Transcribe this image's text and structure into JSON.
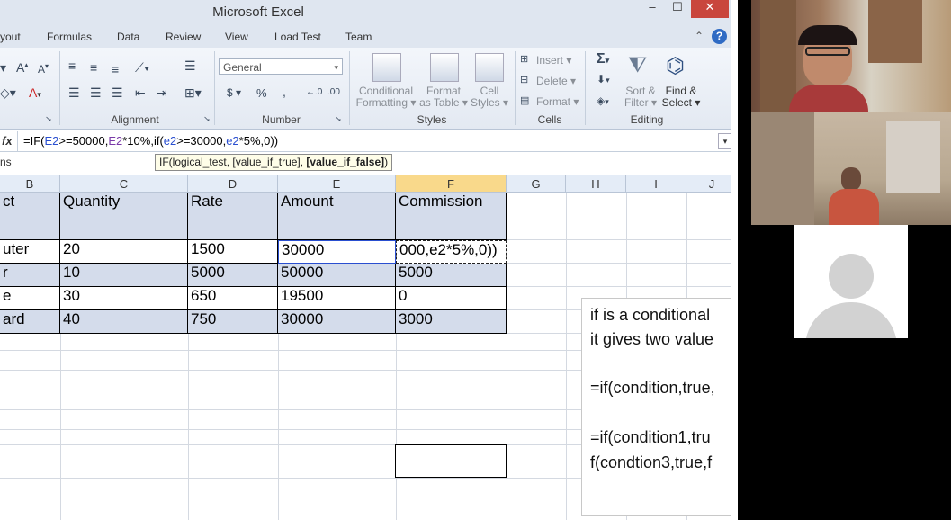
{
  "window": {
    "title": "Microsoft Excel",
    "minimize_glyph": "–",
    "restore_glyph": "☐",
    "close_glyph": "✕"
  },
  "menu": [
    "yout",
    "Formulas",
    "Data",
    "Review",
    "View",
    "Load Test",
    "Team"
  ],
  "ribbon": {
    "number_format": "General",
    "groups": {
      "alignment": "Alignment",
      "number": "Number",
      "styles": "Styles",
      "cells": "Cells",
      "editing": "Editing"
    },
    "styles_buttons": [
      {
        "line1": "Conditional",
        "line2": "Formatting ▾"
      },
      {
        "line1": "Format",
        "line2": "as Table ▾"
      },
      {
        "line1": "Cell",
        "line2": "Styles ▾"
      }
    ],
    "cells_buttons": [
      "Insert ▾",
      "Delete ▾",
      "Format ▾"
    ],
    "editing_buttons": [
      {
        "line1": "Sort &",
        "line2": "Filter ▾"
      },
      {
        "line1": "Find &",
        "line2": "Select ▾"
      }
    ],
    "currency": "$ ▾",
    "percent": "%",
    "comma": ","
  },
  "formula_bar": {
    "fx": "fx",
    "parts": [
      "=IF(",
      "E2",
      ">=50000,",
      "E2",
      "*10%,if(",
      "e2",
      ">=30000,",
      "e2",
      "*5%,0))"
    ],
    "tooltip_plain": "IF(logical_test, [value_if_true], ",
    "tooltip_bold": "[value_if_false]",
    "tooltip_end": ")"
  },
  "name_box_fragment": "ns",
  "columns": [
    "B",
    "C",
    "D",
    "E",
    "F",
    "G",
    "H",
    "I",
    "J"
  ],
  "selected_column": "F",
  "table": {
    "headers": [
      "ct",
      "Quantity",
      "Rate",
      "Amount",
      "Commission"
    ],
    "rows": [
      [
        "uter",
        "20",
        "1500",
        "30000",
        "000,e2*5%,0))"
      ],
      [
        "r",
        "10",
        "5000",
        "50000",
        "5000"
      ],
      [
        "e",
        "30",
        "650",
        "19500",
        "0"
      ],
      [
        "ard",
        "40",
        "750",
        "30000",
        "3000"
      ]
    ]
  },
  "notes": [
    "if is a conditional",
    "it gives two value",
    "",
    "=if(condition,true,",
    "",
    "=if(condition1,tru",
    "f(condtion3,true,f"
  ],
  "colors": {
    "header_fill": "#d4dceb",
    "row_fill": "#d4dceb",
    "selected_col": "#f9d98b",
    "ribbon": "#e3e9f2"
  }
}
